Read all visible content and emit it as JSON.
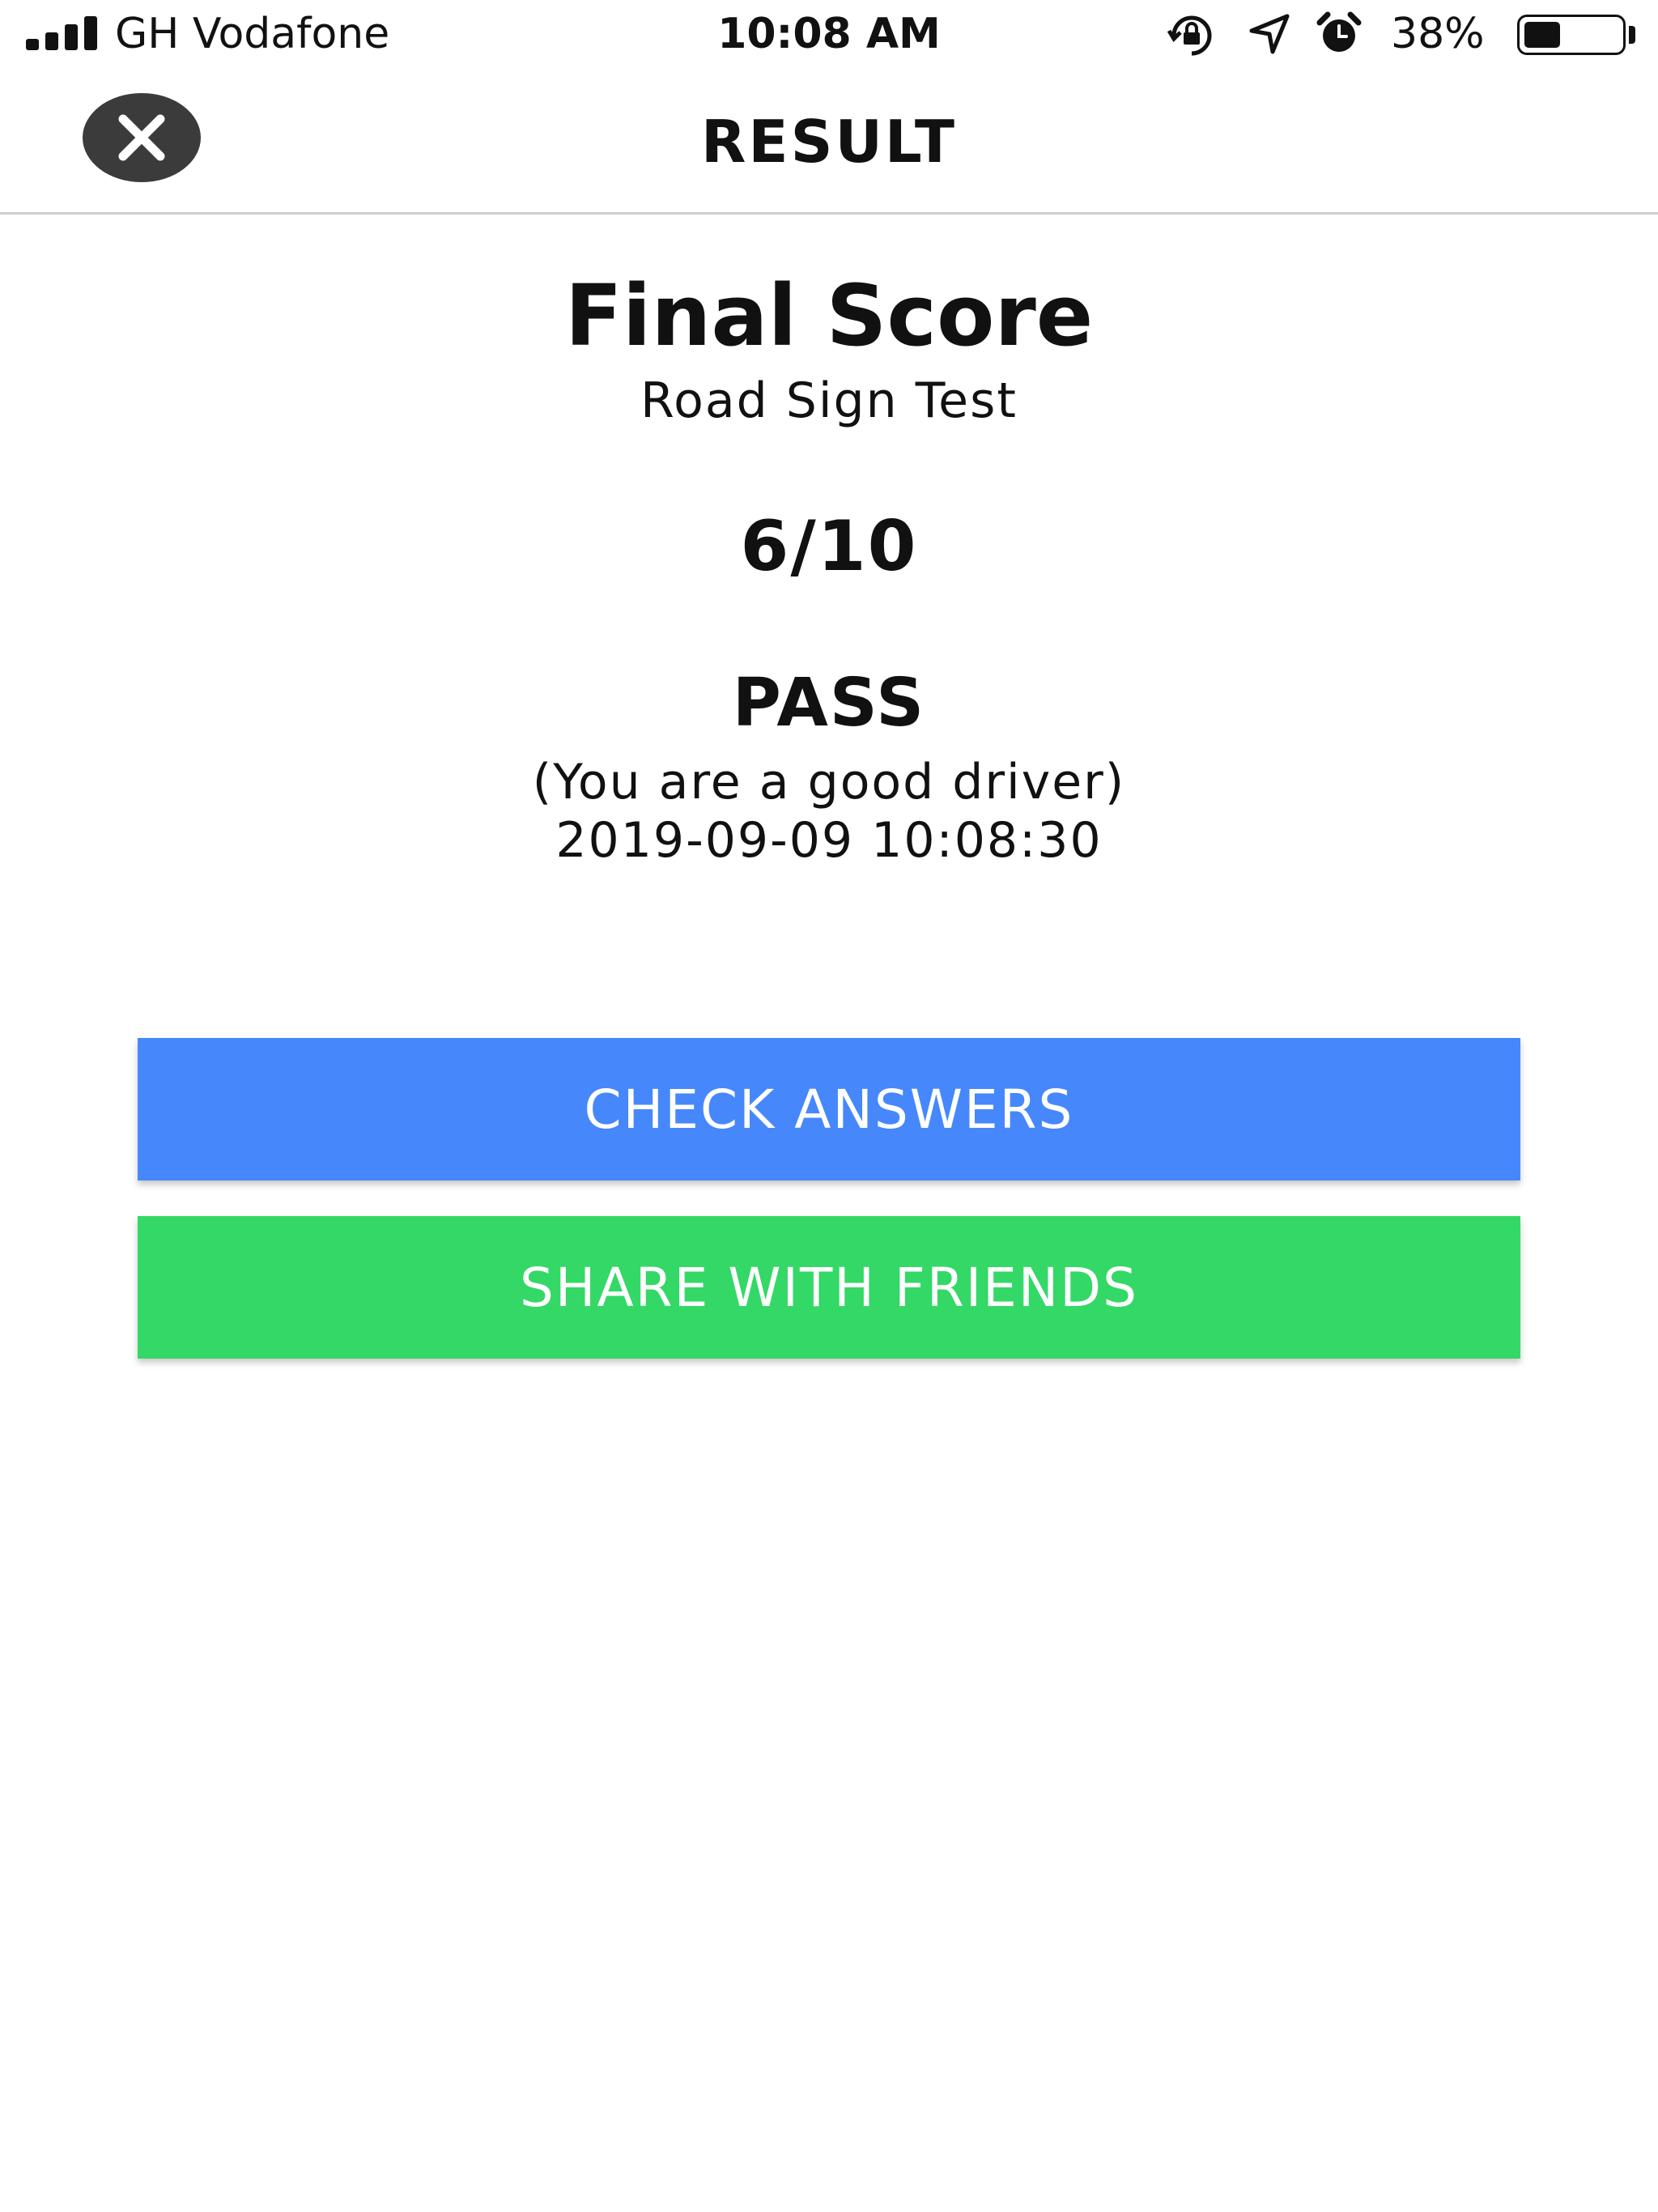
{
  "status_bar": {
    "carrier": "GH Vodafone",
    "time": "10:08 AM",
    "battery_percent_label": "38%",
    "battery_level": 0.38,
    "icons": [
      "signal-icon",
      "orientation-lock-icon",
      "location-icon",
      "alarm-icon",
      "battery-icon"
    ]
  },
  "nav": {
    "title": "RESULT",
    "close_icon": "close-icon"
  },
  "result": {
    "heading": "Final Score",
    "test_name": "Road Sign Test",
    "score": "6/10",
    "status": "PASS",
    "remark": "(You are a good driver)",
    "timestamp": "2019-09-09 10:08:30"
  },
  "actions": {
    "check_answers": "CHECK ANSWERS",
    "share": "SHARE WITH FRIENDS"
  },
  "colors": {
    "check_button": "#4688fb",
    "share_button": "#34d866",
    "close_button": "#3b3b3b"
  }
}
